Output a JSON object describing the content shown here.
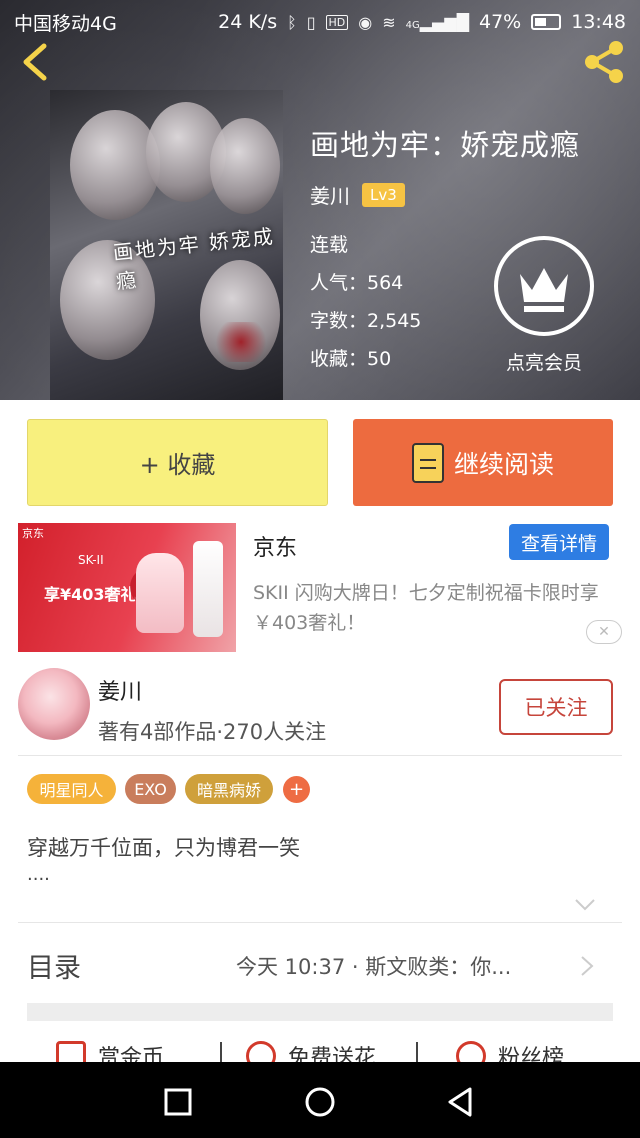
{
  "status_bar": {
    "carrier": "中国移动4G",
    "speed": "24 K/s",
    "hd": "HD",
    "network": "4G",
    "battery": "47%",
    "time": "13:48"
  },
  "book": {
    "title": "画地为牢：娇宠成瘾",
    "cover_text": "画地为牢 娇宠成瘾",
    "author": "姜川",
    "level": "Lv3",
    "status": "连载",
    "popularity": "人气：564",
    "word_count": "字数：2,545",
    "favorites": "收藏：50"
  },
  "vip": {
    "label": "点亮会员"
  },
  "actions": {
    "collect_label": "+ 收藏",
    "read_label": "继续阅读"
  },
  "ad": {
    "brand_tag": "京东",
    "image_brand": "SK-II",
    "image_line": "享¥403奢礼",
    "title": "京东",
    "detail_button": "查看详情",
    "description": "SKII 闪购大牌日！七夕定制祝福卡限时享￥403奢礼！",
    "close_label": "✕"
  },
  "author_section": {
    "name": "姜川",
    "stats": "著有4部作品·270人关注",
    "follow_button": "已关注"
  },
  "tags": [
    "明星同人",
    "EXO",
    "暗黑病娇"
  ],
  "tag_add": "+",
  "synopsis": {
    "text": "穿越万千位面，只为博君一笑",
    "ellipsis": "...."
  },
  "toc": {
    "label": "目录",
    "latest": "今天 10:37 · 斯文败类：你..."
  },
  "bottom_actions": [
    {
      "label": "赏金币"
    },
    {
      "label": "免费送花"
    },
    {
      "label": "粉丝榜"
    }
  ],
  "colors": {
    "accent_yellow": "#f8f07e",
    "accent_orange": "#ed6b3f",
    "follow_red": "#c6453b",
    "detail_blue": "#2e7de3",
    "level_badge": "#f6c343"
  }
}
